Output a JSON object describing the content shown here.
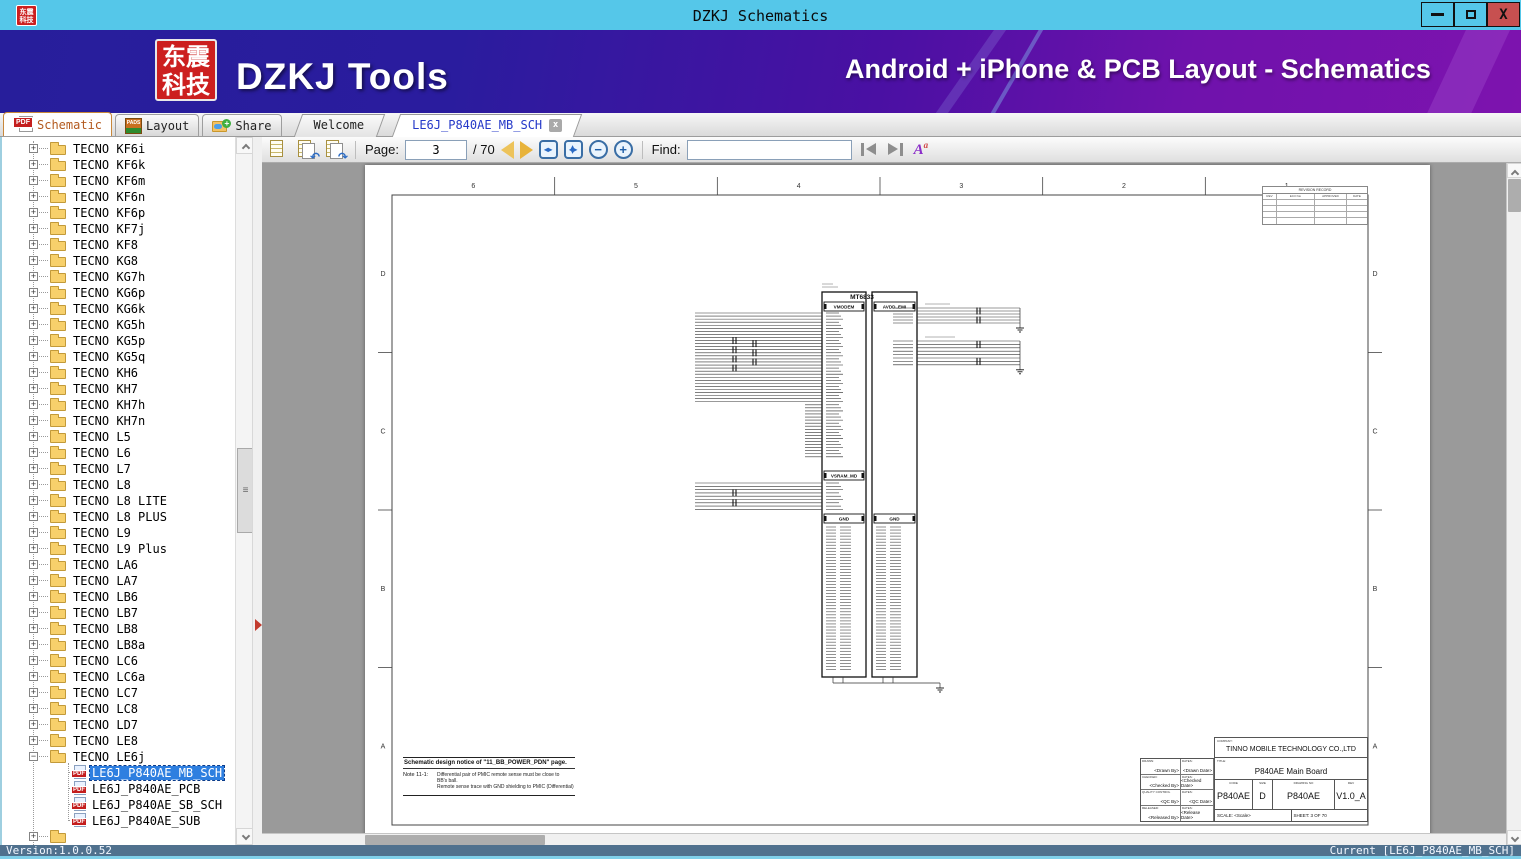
{
  "window": {
    "title": "DZKJ Schematics",
    "close_glyph": "X"
  },
  "banner": {
    "logo_line1": "东震",
    "logo_line2": "科技",
    "app_name": "DZKJ Tools",
    "tagline": "Android + iPhone & PCB Layout - Schematics"
  },
  "tabs": {
    "pdf_badge": "PDF",
    "pads_badge": "PADS",
    "schematic": "Schematic",
    "layout": "Layout",
    "share": "Share",
    "share_plus": "+",
    "documents": [
      {
        "label": "Welcome",
        "active": false,
        "closable": false
      },
      {
        "label": "LE6J_P840AE_MB_SCH",
        "active": true,
        "closable": true
      }
    ],
    "close_glyph": "x"
  },
  "toolbar": {
    "page_label": "Page:",
    "page_value": "3",
    "page_total": "/ 70",
    "find_label": "Find:",
    "rotate_left_glyph": "↶",
    "rotate_right_glyph": "↷",
    "fit_glyph": "◂▸",
    "zoom_out_glyph": "−",
    "zoom_in_glyph": "+",
    "match_case": "A",
    "match_case_sup": "a"
  },
  "sidebar": {
    "collapsed_glyph": "+",
    "expanded_glyph": "−",
    "pdf_badge": "PDF",
    "folders": [
      "TECNO KF6i",
      "TECNO KF6k",
      "TECNO KF6m",
      "TECNO KF6n",
      "TECNO KF6p",
      "TECNO KF7j",
      "TECNO KF8",
      "TECNO KG8",
      "TECNO KG7h",
      "TECNO KG6p",
      "TECNO KG6k",
      "TECNO KG5h",
      "TECNO KG5p",
      "TECNO KG5q",
      "TECNO KH6",
      "TECNO KH7",
      "TECNO KH7h",
      "TECNO KH7n",
      "TECNO L5",
      "TECNO L6",
      "TECNO L7",
      "TECNO L8",
      "TECNO L8 LITE",
      "TECNO L8 PLUS",
      "TECNO L9",
      "TECNO L9 Plus",
      "TECNO LA6",
      "TECNO LA7",
      "TECNO LB6",
      "TECNO LB7",
      "TECNO LB8",
      "TECNO LB8a",
      "TECNO LC6",
      "TECNO LC6a",
      "TECNO LC7",
      "TECNO LC8",
      "TECNO LD7",
      "TECNO LE8",
      "TECNO LE6j"
    ],
    "expanded": "TECNO LE6j",
    "files": [
      "LE6J_P840AE_MB_SCH",
      "LE6J_P840AE_PCB",
      "LE6J_P840AE_SB_SCH",
      "LE6J_P840AE_SUB"
    ],
    "selected": "LE6J_P840AE_MB_SCH"
  },
  "schematic": {
    "columns": [
      "6",
      "5",
      "4",
      "3",
      "2",
      "1"
    ],
    "rows": [
      "D",
      "C",
      "B",
      "A"
    ],
    "chip": {
      "name": "MT6833",
      "sections": {
        "left_top": "VMODEM",
        "right_top": "AVDD_EMI",
        "left_mid": "VSRAM_MD",
        "left_gnd": "GND",
        "right_gnd": "GND"
      }
    },
    "revision_table": {
      "title": "REVISION RECORD",
      "headers": [
        "REV",
        "ECO No",
        "APPROVED",
        "DATE"
      ],
      "empty_rows": 4
    },
    "note": {
      "heading": "Schematic design notice of \"11_BB_POWER_PDN\" page.",
      "label": "Note 11-1:",
      "lines": [
        "Differential pair of PMIC remote sense must be close to",
        "BB's ball.",
        "Remote sense trace with GND shielding to PMIC (Differential)"
      ]
    },
    "title_block": {
      "company_label": "COMPANY:",
      "company": "TINNO MOBILE TECHNOLOGY CO.,LTD",
      "title_label": "TITLE:",
      "title": "P840AE Main Board",
      "cells": [
        {
          "label": "CODE",
          "value": "P840AE"
        },
        {
          "label": "SIZE",
          "value": "D"
        },
        {
          "label": "DRAWING NO",
          "value": "P840AE"
        },
        {
          "label": "REV",
          "value": "V1.0_A"
        }
      ],
      "fields": [
        {
          "l1": "DRAWN:",
          "v1": "<Drawn By>",
          "l2": "DATES:",
          "v2": "<Drawn Date>"
        },
        {
          "l1": "CHECKED:",
          "v1": "<Checked By>",
          "l2": "DATES:",
          "v2": "<Checked Date>"
        },
        {
          "l1": "QUALITY CONTROL",
          "v1": "<QC By>",
          "l2": "DATES:",
          "v2": "<QC Date>"
        },
        {
          "l1": "RELEASED:",
          "v1": "<Released By>",
          "l2": "DATES:",
          "v2": "<Release Date>"
        }
      ],
      "scale_label": "SCALE:",
      "scale": "<Scale>",
      "sheet_label": "SHEET:",
      "sheet": "3 OF 70"
    }
  },
  "statusbar": {
    "version": "Version:1.0.0.52",
    "current": "Current [LE6J_P840AE_MB_SCH]"
  },
  "colors": {
    "titlebar": "#55C7E9",
    "close_button": "#C75050",
    "banner_left": "#271E9B",
    "banner_right": "#7D13AE",
    "logo_red": "#CC1F1F",
    "selection": "#2E7FE0",
    "status_bg": "#50718E",
    "status_strip": "#7FD0EA",
    "viewer_bg": "#9A9A9A",
    "active_tab_text": "#B35A1F",
    "doc_tab_text": "#2438C8"
  }
}
